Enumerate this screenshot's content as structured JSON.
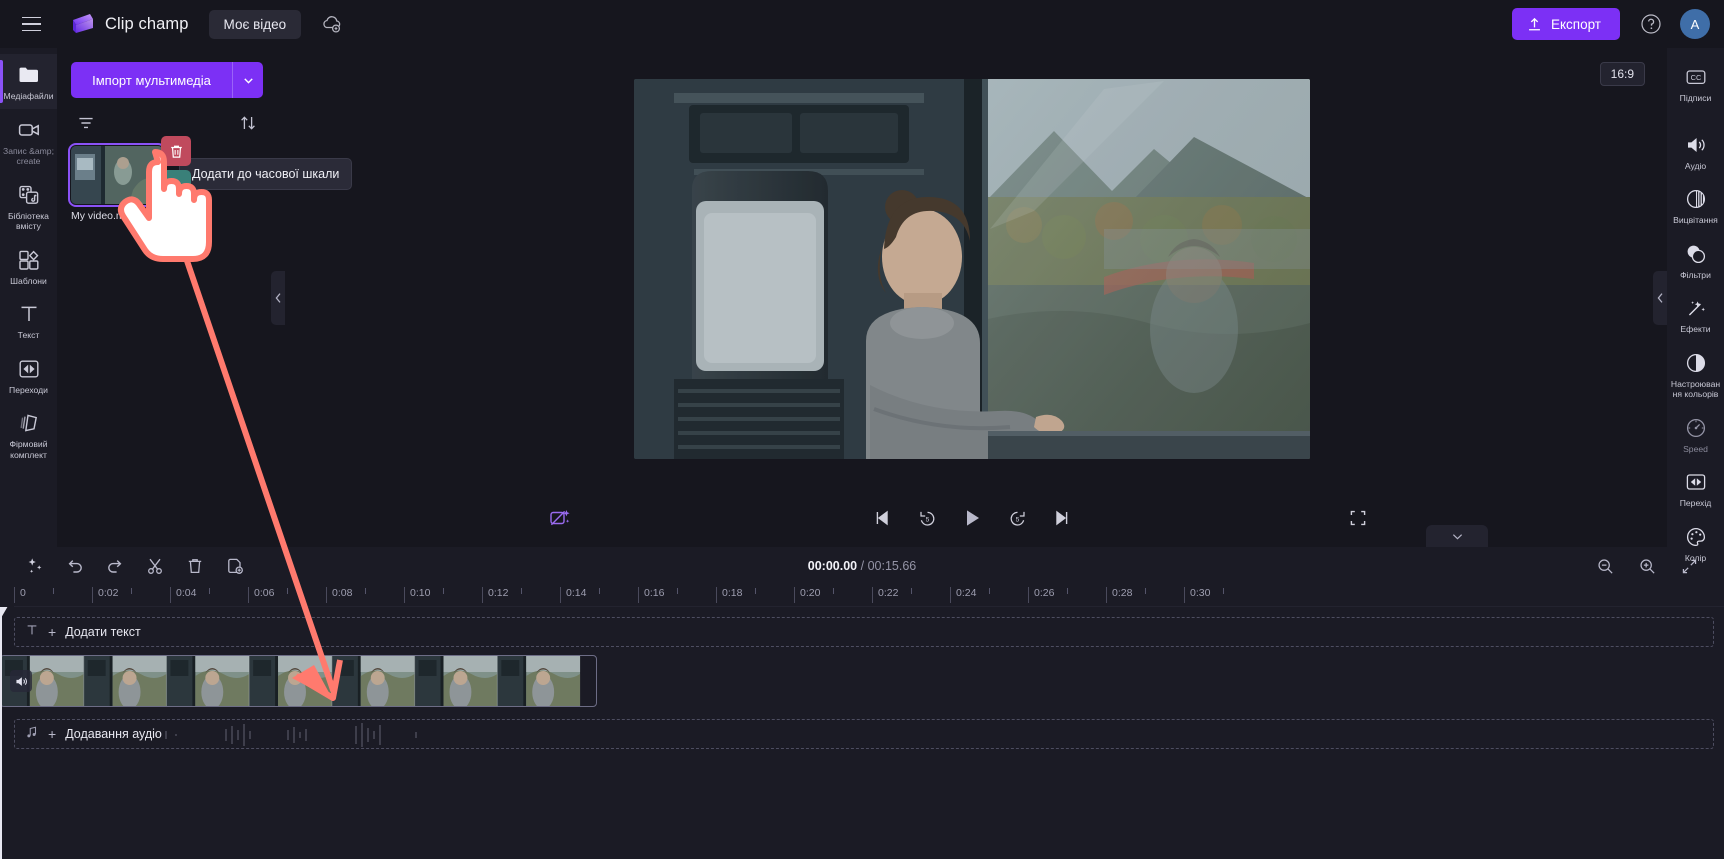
{
  "app": {
    "brand_name": "Clip champ",
    "project_name": "Моє відео",
    "export_label": "Експорт",
    "avatar_initial": "A"
  },
  "left_rail": [
    {
      "label": "Медіафайли",
      "icon": "folder-icon",
      "active": true,
      "dim": false
    },
    {
      "label": "Запис &amp; create",
      "icon": "video-camera-icon",
      "active": false,
      "dim": true
    },
    {
      "label": "Бібліотека вмісту",
      "icon": "content-library-icon",
      "active": false,
      "dim": false
    },
    {
      "label": "Шаблони",
      "icon": "templates-icon",
      "active": false,
      "dim": false
    },
    {
      "label": "Текст",
      "icon": "text-icon",
      "active": false,
      "dim": false
    },
    {
      "label": "Переходи",
      "icon": "transitions-icon",
      "active": false,
      "dim": false
    },
    {
      "label": "Фірмовий комплект",
      "icon": "brand-kit-icon",
      "active": false,
      "dim": false
    }
  ],
  "media_panel": {
    "import_label": "Імпорт мультимедіа",
    "filter_icon": "filter-icon",
    "sort_icon": "sort-icon",
    "tooltip": "Додати до часової шкали",
    "item": {
      "name": "My video.mp4",
      "delete_icon": "trash-icon",
      "add_icon": "plus-icon"
    }
  },
  "stage": {
    "aspect_ratio": "16:9",
    "controls": {
      "autofix_icon": "magic-fix-icon",
      "skip_start_icon": "skip-to-start-icon",
      "back5_icon": "rewind-5-icon",
      "play_icon": "play-icon",
      "fwd5_icon": "forward-5-icon",
      "skip_end_icon": "skip-to-end-icon",
      "fullscreen_icon": "fullscreen-icon"
    }
  },
  "right_rail": [
    {
      "label": "Підписи",
      "icon": "captions-cc-icon",
      "sep_after": true,
      "dim": false
    },
    {
      "label": "Аудіо",
      "icon": "speaker-icon",
      "sep_after": false,
      "dim": false
    },
    {
      "label": "Вицвітання",
      "icon": "fade-icon",
      "sep_after": false,
      "dim": false
    },
    {
      "label": "Фільтри",
      "icon": "filters-circles-icon",
      "sep_after": false,
      "dim": false
    },
    {
      "label": "Ефекти",
      "icon": "magic-wand-icon",
      "sep_after": false,
      "dim": false
    },
    {
      "label": "Настроювання кольорів",
      "icon": "contrast-icon",
      "sep_after": false,
      "dim": false
    },
    {
      "label": "Speed",
      "icon": "speedometer-icon",
      "sep_after": false,
      "dim": true
    },
    {
      "label": "Перехід",
      "icon": "transitions-icon",
      "sep_after": false,
      "dim": false
    },
    {
      "label": "Колір",
      "icon": "palette-icon",
      "sep_after": false,
      "dim": false
    }
  ],
  "timeline": {
    "toolbar_icons": [
      "auto-compose-icon",
      "undo-icon",
      "redo-icon",
      "split-scissors-icon",
      "delete-trash-icon",
      "duplicate-icon"
    ],
    "current_time": "00:00.00",
    "separator": "/",
    "total_time": "00:15.66",
    "zoom_out_icon": "zoom-out-icon",
    "zoom_in_icon": "zoom-in-icon",
    "fit_icon": "fit-to-screen-icon",
    "ruler_ticks": [
      "0",
      "0:02",
      "0:04",
      "0:06",
      "0:08",
      "0:10",
      "0:12",
      "0:14",
      "0:16",
      "0:18",
      "0:20",
      "0:22",
      "0:24",
      "0:26",
      "0:28",
      "0:30"
    ],
    "text_track": {
      "label": "Додати текст",
      "icon": "text-T-icon",
      "plus": "+"
    },
    "audio_track": {
      "label": "Додавання аудіо",
      "icon": "music-note-icon",
      "plus": "+"
    },
    "video_clip": {
      "audio_icon": "clip-speaker-icon"
    }
  },
  "colors": {
    "accent_purple": "#7c30f5",
    "cursor_coral": "#ff7a6e",
    "panel_bg": "#1b1b25",
    "app_bg": "#16161e"
  }
}
